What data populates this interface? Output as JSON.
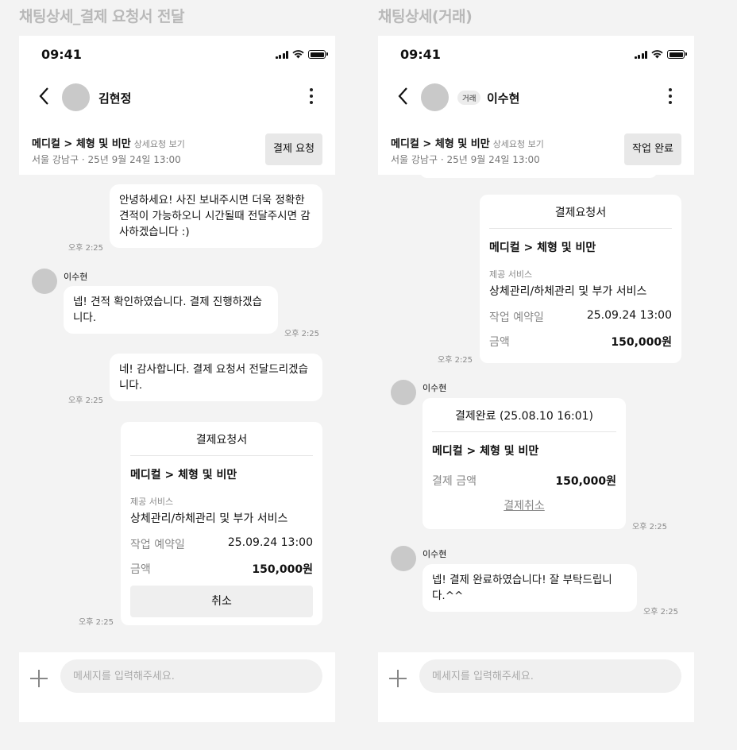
{
  "left": {
    "frame_title": "채팅상세_결제 요청서 전달",
    "status": {
      "time": "09:41"
    },
    "nav": {
      "name": "김현정"
    },
    "service": {
      "title": "메디컬 > 체형 및 비만",
      "link": "상세요청 보기",
      "sub": "서울 강남구 · 25년 9월 24일 13:00",
      "button": "결제 요청"
    },
    "messages": {
      "m1": {
        "text": "안녕하세요! 사진 보내주시면 더욱 정확한 견적이 가능하오니 시간될때 전달주시면 감사하겠습니다 :)",
        "time": "오후 2:25"
      },
      "m2": {
        "sender": "이수현",
        "text": "넵! 견적 확인하였습니다. 결제 진행하겠습니다.",
        "time": "오후 2:25"
      },
      "m3": {
        "text": "네! 감사합니다. 결제 요청서 전달드리겠습니다.",
        "time": "오후 2:25"
      }
    },
    "card": {
      "title": "결제요청서",
      "service": "메디컬 > 체형 및 비만",
      "provided_label": "제공 서비스",
      "provided_value": "상체관리/하체관리 및 부가 서비스",
      "date_label": "작업 예약일",
      "date_value": "25.09.24 13:00",
      "amount_label": "금액",
      "amount_value": "150,000원",
      "cancel": "취소",
      "time": "오후 2:25"
    },
    "composer": {
      "placeholder": "메세지를 입력해주세요."
    }
  },
  "right": {
    "frame_title": "채팅상세(거래)",
    "status": {
      "time": "09:41"
    },
    "nav": {
      "tag": "거래",
      "name": "이수현"
    },
    "service": {
      "title": "메디컬 > 체형 및 비만",
      "link": "상세요청 보기",
      "sub": "서울 강남구 · 25년 9월 24일 13:00",
      "button": "작업 완료"
    },
    "card": {
      "title": "결제요청서",
      "service": "메디컬 > 체형 및 비만",
      "provided_label": "제공 서비스",
      "provided_value": "상체관리/하체관리 및 부가 서비스",
      "date_label": "작업 예약일",
      "date_value": "25.09.24 13:00",
      "amount_label": "금액",
      "amount_value": "150,000원",
      "time": "오후 2:25"
    },
    "paid_card": {
      "sender": "이수현",
      "title": "결제완료 (25.08.10 16:01)",
      "service": "메디컬 > 체형 및 비만",
      "amount_label": "결제 금액",
      "amount_value": "150,000원",
      "cancel_link": "결제취소",
      "time": "오후 2:25"
    },
    "last_msg": {
      "sender": "이수현",
      "text": "넵! 결제 완료하였습니다! 잘 부탁드립니다.^^",
      "time": "오후 2:25"
    },
    "composer": {
      "placeholder": "메세지를 입력해주세요."
    }
  }
}
